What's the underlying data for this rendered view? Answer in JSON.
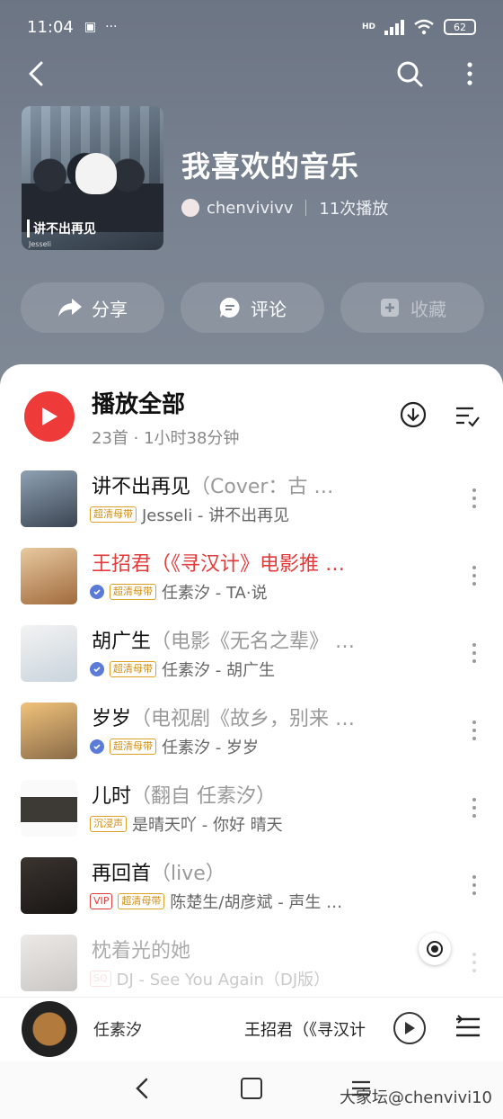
{
  "status_bar": {
    "time": "11:04",
    "misc": "···",
    "network": "HD",
    "battery": "62"
  },
  "header": {
    "playlist_title": "我喜欢的音乐",
    "owner_name": "chenvivivv",
    "play_count": "11次播放",
    "cover": {
      "title": "讲不出再见",
      "artist": "Jesseli"
    }
  },
  "actions": {
    "share": "分享",
    "comment": "评论",
    "collect": "收藏"
  },
  "play_all": {
    "title": "播放全部",
    "subtitle": "23首 · 1小时38分钟"
  },
  "songs": [
    {
      "title": "讲不出再见",
      "alt": "（Cover：古 …",
      "tags": [
        "超清母带"
      ],
      "verified": false,
      "artist_album": "Jesseli - 讲不出再见",
      "playing": false
    },
    {
      "title": "王招君（《寻汉计》电影推 …",
      "alt": "",
      "tags": [
        "超清母带"
      ],
      "verified": true,
      "artist_album": "任素汐 - TA·说",
      "playing": true
    },
    {
      "title": "胡广生",
      "alt": "（电影《无名之辈》 …",
      "tags": [
        "超清母带"
      ],
      "verified": true,
      "artist_album": "任素汐 - 胡广生",
      "playing": false
    },
    {
      "title": "岁岁",
      "alt": "（电视剧《故乡，别来 …",
      "tags": [
        "超清母带"
      ],
      "verified": true,
      "artist_album": "任素汐 - 岁岁",
      "playing": false
    },
    {
      "title": "儿时",
      "alt": "（翻自 任素汐）",
      "tags": [
        "沉浸声"
      ],
      "verified": false,
      "artist_album": "是晴天吖 - 你好 晴天",
      "playing": false
    },
    {
      "title": "再回首",
      "alt": "（live）",
      "tags": [
        "VIP",
        "超清母带"
      ],
      "verified": false,
      "artist_album": "陈楚生/胡彦斌 - 声生 …",
      "playing": false
    },
    {
      "title": "枕着光的她",
      "alt": "",
      "tags": [
        "SQ"
      ],
      "verified": false,
      "artist_album": "DJ - See You Again（DJ版）",
      "playing": false
    }
  ],
  "mini_player": {
    "artist": "任素汐",
    "title": "王招君（《寻汉计"
  },
  "watermark": "大家坛@chenvivi10",
  "colors": {
    "accent_red": "#ef3a3a",
    "tag_gold": "#d48d10",
    "header_bg": "#7a8391"
  }
}
